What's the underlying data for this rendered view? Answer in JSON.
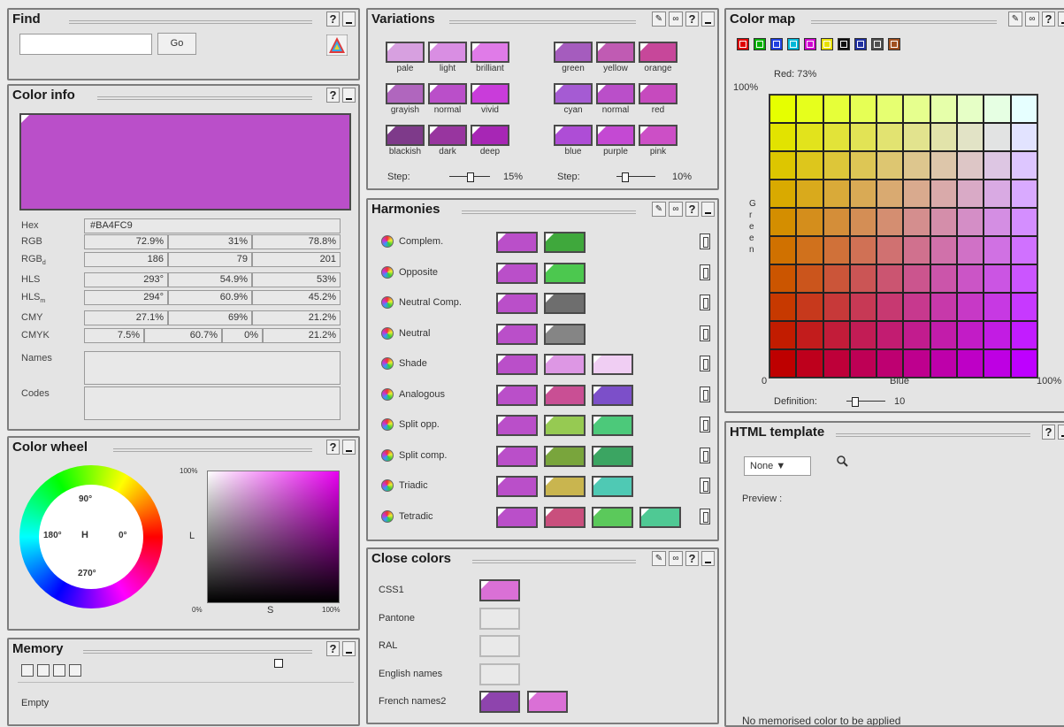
{
  "find": {
    "title": "Find",
    "help": "?",
    "go_label": "Go",
    "input_value": ""
  },
  "color_info": {
    "title": "Color info",
    "help": "?",
    "swatch_color": "#BA4FC9",
    "rows": [
      {
        "label": "Hex",
        "cells": [
          "#BA4FC9"
        ]
      },
      {
        "label": "RGB",
        "cells": [
          "72.9%",
          "31%",
          "78.8%"
        ]
      },
      {
        "label": "RGB",
        "sub": "d",
        "cells": [
          "186",
          "79",
          "201"
        ]
      },
      {
        "label": "HLS",
        "cells": [
          "293°",
          "54.9%",
          "53%"
        ]
      },
      {
        "label": "HLS",
        "sub": "m",
        "cells": [
          "294°",
          "60.9%",
          "45.2%"
        ]
      },
      {
        "label": "CMY",
        "cells": [
          "27.1%",
          "69%",
          "21.2%"
        ]
      },
      {
        "label": "CMYK",
        "cells": [
          "7.5%",
          "60.7%",
          "0%",
          "21.2%"
        ]
      },
      {
        "label": "Names",
        "cells": [
          ""
        ]
      },
      {
        "label": "Codes",
        "cells": [
          ""
        ]
      }
    ]
  },
  "color_wheel": {
    "title": "Color wheel",
    "help": "?",
    "deg90": "90°",
    "deg180": "180°",
    "deg0": "0°",
    "deg270": "270°",
    "h": "H",
    "l_label": "L",
    "s_label": "S",
    "pct100_top": "100%",
    "pct0": "0%",
    "pct100_right": "100%"
  },
  "memory": {
    "title": "Memory",
    "help": "?",
    "empty": "Empty"
  },
  "variations": {
    "title": "Variations",
    "help": "?",
    "left_grid": [
      [
        {
          "label": "pale",
          "color": "#D7A0E0"
        },
        {
          "label": "light",
          "color": "#D98EE3"
        },
        {
          "label": "brilliant",
          "color": "#E07BE8"
        }
      ],
      [
        {
          "label": "grayish",
          "color": "#B066BE"
        },
        {
          "label": "normal",
          "color": "#BA4FC9"
        },
        {
          "label": "vivid",
          "color": "#C93CDA"
        }
      ],
      [
        {
          "label": "blackish",
          "color": "#7E3A8A"
        },
        {
          "label": "dark",
          "color": "#98359F"
        },
        {
          "label": "deep",
          "color": "#A726B5"
        }
      ]
    ],
    "right_grid": [
      [
        {
          "label": "green",
          "color": "#A55CBE"
        },
        {
          "label": "yellow",
          "color": "#C05BB3"
        },
        {
          "label": "orange",
          "color": "#C7479A"
        }
      ],
      [
        {
          "label": "cyan",
          "color": "#A55BD3"
        },
        {
          "label": "normal",
          "color": "#BA4FC9"
        },
        {
          "label": "red",
          "color": "#C64ABE"
        }
      ],
      [
        {
          "label": "blue",
          "color": "#AE4DD6"
        },
        {
          "label": "purple",
          "color": "#C449D3"
        },
        {
          "label": "pink",
          "color": "#CC4FC6"
        }
      ]
    ],
    "step_label": "Step:",
    "step_left": "15%",
    "step_right": "10%"
  },
  "harmonies": {
    "title": "Harmonies",
    "help": "?",
    "rows": [
      {
        "name": "Complem.",
        "colors": [
          "#BA4FC9",
          "#3FA83C"
        ]
      },
      {
        "name": "Opposite",
        "colors": [
          "#BA4FC9",
          "#4CC84F"
        ]
      },
      {
        "name": "Neutral Comp.",
        "colors": [
          "#BA4FC9",
          "#6E6E6E"
        ]
      },
      {
        "name": "Neutral",
        "colors": [
          "#BA4FC9",
          "#858585"
        ]
      },
      {
        "name": "Shade",
        "colors": [
          "#BA4FC9",
          "#DD97E4",
          "#F0CEF3"
        ]
      },
      {
        "name": "Analogous",
        "colors": [
          "#BA4FC9",
          "#C94F94",
          "#7C4FC9"
        ]
      },
      {
        "name": "Split opp.",
        "colors": [
          "#BA4FC9",
          "#96CA52",
          "#4CC97A"
        ]
      },
      {
        "name": "Split comp.",
        "colors": [
          "#BA4FC9",
          "#79A53C",
          "#3BA562"
        ]
      },
      {
        "name": "Triadic",
        "colors": [
          "#BA4FC9",
          "#C9B54F",
          "#4FC9B4"
        ]
      },
      {
        "name": "Tetradic",
        "colors": [
          "#BA4FC9",
          "#C94F7D",
          "#5BC95B",
          "#4FC994"
        ]
      }
    ]
  },
  "close_colors": {
    "title": "Close colors",
    "help": "?",
    "rows": [
      {
        "label": "CSS1",
        "colors": [
          "#DA70D6"
        ]
      },
      {
        "label": "Pantone",
        "colors": []
      },
      {
        "label": "RAL",
        "colors": []
      },
      {
        "label": "English names",
        "colors": []
      },
      {
        "label": "French names2",
        "colors": [
          "#8E44AD",
          "#DA70D6"
        ]
      }
    ]
  },
  "color_map": {
    "title": "Color map",
    "help": "?",
    "red_label": "Red: 73%",
    "pct100": "100%",
    "zero": "0",
    "blue": "Blue",
    "pct100_right": "100%",
    "green_v": [
      "G",
      "r",
      "e",
      "e",
      "n"
    ],
    "definition_label": "Definition:",
    "definition_value": "10",
    "preset_colors": [
      "#E00000",
      "#00B000",
      "#2040E0",
      "#00B8D8",
      "#D000D0",
      "#E8E000",
      "#111111",
      "#2030A0",
      "#505050",
      "#A05020"
    ]
  },
  "html_template": {
    "title": "HTML template",
    "help": "?",
    "select_value": "None ▼",
    "preview_label": "Preview :",
    "footer_text": "No memorised color to be applied"
  }
}
